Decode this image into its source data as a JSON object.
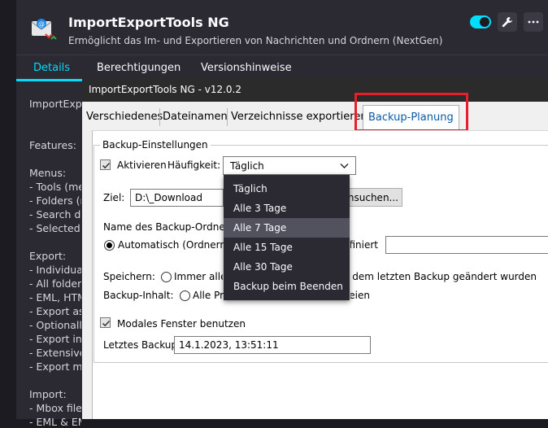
{
  "addon": {
    "title": "ImportExportTools NG",
    "description": "Ermöglicht das Im- und Exportieren von Nachrichten und Ordnern (NextGen)"
  },
  "addon_tabs": [
    {
      "label": "Details",
      "active": true
    },
    {
      "label": "Berechtigungen",
      "active": false
    },
    {
      "label": "Versionshinweise",
      "active": false
    }
  ],
  "sidebar_lines": [
    "ImportExportTools NG",
    "Features:",
    "Menus:",
    "- Tools (menu)",
    "- Folders (menu)",
    "- Search dialog",
    "- Selected messages",
    "Export:",
    "- Individual messages",
    "- All folder",
    "- EML, HTML",
    "- Export as",
    "- Optionally",
    "- Export index",
    "- Extensive",
    "- Export messages",
    "Import:",
    "- Mbox files",
    "- EML & EMLX"
  ],
  "dialog": {
    "title": "ImportExportTools NG - v12.0.2",
    "tabs": [
      {
        "label": "Verschiedenes",
        "active": false
      },
      {
        "label": "Dateinamen",
        "active": false
      },
      {
        "label": "Verzeichnisse exportieren",
        "active": false
      },
      {
        "label": "Backup-Planung",
        "active": true
      }
    ],
    "group_label": "Backup-Einstellungen",
    "activate_label": "Aktivieren",
    "activate_checked": true,
    "frequency_label": "Häufigkeit:",
    "frequency_value": "Täglich",
    "target_label": "Ziel:",
    "target_value": "D:\\_Download",
    "browse_label": "Durchsuchen...",
    "folder_name_label": "Name des Backup-Ordners:",
    "auto_label": "Automatisch (Ordnername",
    "custom_label": "Benutzerdefiniert:",
    "custom_value": "",
    "save_label": "Speichern:",
    "save_all_label": "Immer alle",
    "save_changed_label": "Nur Dateien, die nach dem letzten Backup geändert wurden",
    "content_label": "Backup-Inhalt:",
    "content_all_label": "Alle Profildateien",
    "content_mail_label": "Nur Maildateien",
    "modal_label": "Modales Fenster benutzen",
    "modal_checked": true,
    "last_backup_label": "Letztes Backup:",
    "last_backup_value": "14.1.2023, 13:51:11"
  },
  "dropdown_options": [
    {
      "label": "Täglich",
      "hover": false
    },
    {
      "label": "Alle 3 Tage",
      "hover": false
    },
    {
      "label": "Alle 7 Tage",
      "hover": true
    },
    {
      "label": "Alle 15 Tage",
      "hover": false
    },
    {
      "label": "Alle 30 Tage",
      "hover": false
    },
    {
      "label": "Backup beim Beenden",
      "hover": false
    }
  ],
  "colors": {
    "accent": "#00ddff",
    "highlight_box": "#e6202a",
    "dialog_tab_active": "#0b5aa8"
  },
  "icons": [
    "addon-icon",
    "wrench-icon",
    "more-icon",
    "chevron-down-icon",
    "checkmark-icon"
  ]
}
